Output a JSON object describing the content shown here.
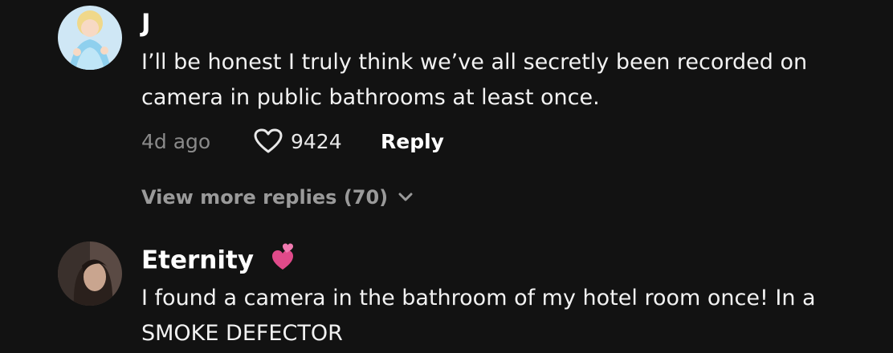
{
  "comments": [
    {
      "username": "J",
      "text": "I’ll be honest I truly think we’ve all secretly been recorded on camera in public bathrooms at least once.",
      "timestamp": "4d ago",
      "likes": "9424",
      "reply_label": "Reply",
      "view_more_label": "View more replies (70)",
      "avatar_icon": "cartoon-princess-avatar"
    },
    {
      "username": "Eternity",
      "username_emoji": "two-hearts-emoji",
      "text": "I found a camera in the bathroom of my hotel room once! In a SMOKE DEFECTOR",
      "avatar_icon": "user-photo-avatar"
    }
  ],
  "colors": {
    "background": "#121212",
    "text_primary": "#ffffff",
    "text_secondary": "#8a8a8a",
    "heart_emoji": "#e04a8a"
  }
}
